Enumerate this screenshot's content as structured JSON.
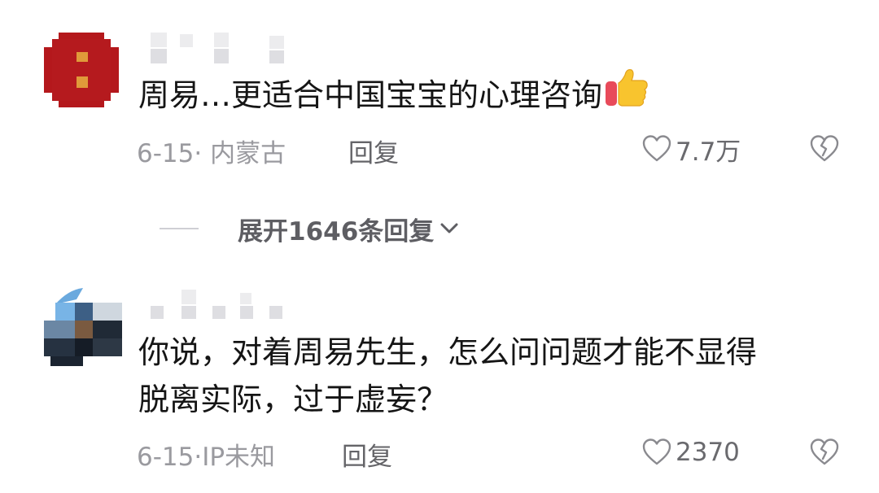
{
  "comments": [
    {
      "text_lines": [
        "周易…更适合中国宝宝的心理咨询"
      ],
      "emoji": "thumbs-up-icon",
      "meta": "6-15· 内蒙古",
      "reply_label": "回复",
      "likes": "7.7万"
    },
    {
      "text_lines": [
        "你说，对着周易先生，怎么问问题才能不显得",
        "脱离实际，过于虚妄？"
      ],
      "meta": "6-15·IP未知",
      "reply_label": "回复",
      "likes": "2370"
    }
  ],
  "expand_replies_label": "展开1646条回复",
  "colors": {
    "text": "#151515",
    "meta": "#9a9a9f",
    "avatar_red": "#b4181c",
    "avatar_orange": "#e09a3a"
  }
}
